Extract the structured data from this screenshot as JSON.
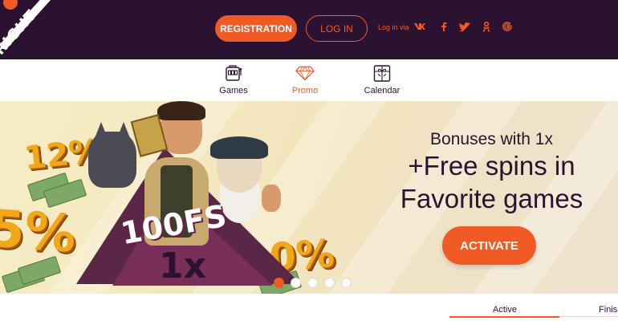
{
  "header": {
    "logo_text": "RIGHT",
    "registration_label": "REGISTRATION",
    "login_label": "LOG IN",
    "login_via_label": "Log in via",
    "social_icons": [
      "vk-icon",
      "facebook-icon",
      "twitter-icon",
      "odnoklassniki-icon",
      "google-icon"
    ]
  },
  "nav": {
    "items": [
      {
        "label": "Games",
        "icon": "slot-machine-icon"
      },
      {
        "label": "Promo",
        "icon": "diamond-icon"
      },
      {
        "label": "Calendar",
        "icon": "calendar-gift-icon"
      }
    ],
    "active": "Promo"
  },
  "banner": {
    "line1": "Bonuses with 1x",
    "line2": "+Free spins in",
    "line3": "Favorite games",
    "activate_label": "ACTIVATE",
    "badge_fs": "100FS",
    "badge_x": "1x",
    "percent_a": "12%",
    "percent_b": "5%",
    "percent_c": "10%",
    "slide_count": 5,
    "active_slide": 1
  },
  "tabs": {
    "active_label": "Active",
    "finished_label": "Finish"
  },
  "colors": {
    "header_bg": "#2b1231",
    "accent": "#f05a24",
    "text_dark": "#2b1231"
  }
}
